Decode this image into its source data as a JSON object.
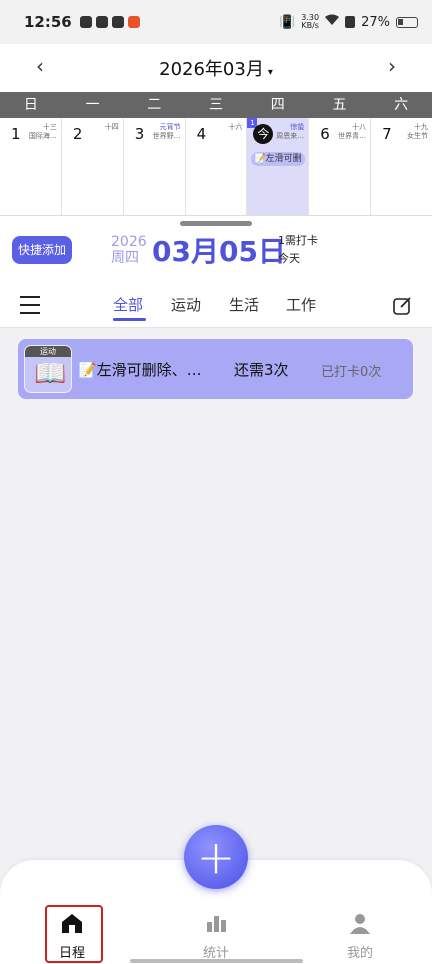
{
  "status_bar": {
    "time": "12:56",
    "speed_top": "3.30",
    "speed_bottom": "KB/s",
    "battery": "27%"
  },
  "header": {
    "month_title": "2026年03月",
    "caret": "▾",
    "prev": "‹",
    "next": "›"
  },
  "weekdays": [
    "日",
    "一",
    "二",
    "三",
    "四",
    "五",
    "六"
  ],
  "days": [
    {
      "num": "1",
      "lunar": "十三",
      "note": "国际海…"
    },
    {
      "num": "2",
      "lunar": "十四",
      "note": ""
    },
    {
      "num": "3",
      "lunar": "元宵节",
      "note": "世界野…"
    },
    {
      "num": "4",
      "lunar": "十六",
      "note": ""
    },
    {
      "num": "今",
      "lunar": "惊蛰",
      "note": "周恩来…",
      "corner": "1",
      "event": "📝左滑可删"
    },
    {
      "num": "6",
      "lunar": "十八",
      "note": "世界青…"
    },
    {
      "num": "7",
      "lunar": "十九",
      "note": "女生节"
    }
  ],
  "summary": {
    "quick_add": "快捷添加",
    "year": "2026",
    "weekday": "周四",
    "date": "03月05日",
    "check_count": "1需打卡",
    "relative": "今天"
  },
  "tabs": {
    "all": "全部",
    "sport": "运动",
    "life": "生活",
    "work": "工作"
  },
  "task": {
    "tag": "运动",
    "icon": "📖",
    "title": "📝左滑可删除、…",
    "remaining": "还需3次",
    "done": "已打卡0次"
  },
  "fab": "+",
  "bottom_nav": {
    "home": "日程",
    "stats": "统计",
    "mine": "我的"
  }
}
